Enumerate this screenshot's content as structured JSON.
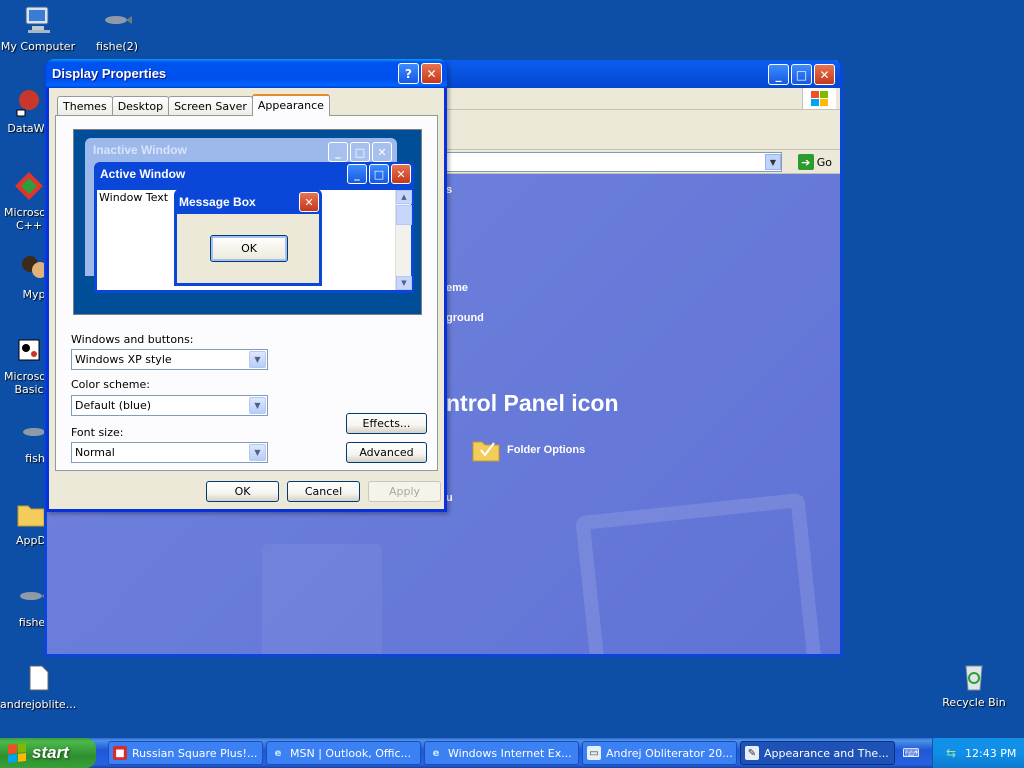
{
  "desktop": {
    "icons": [
      {
        "label": "My Computer",
        "icon": "computer-icon"
      },
      {
        "label": "fishe(2)",
        "icon": "fish-icon"
      },
      {
        "label": "DataWa",
        "icon": "datawa-icon"
      },
      {
        "label": "Microsoft C++",
        "icon": "visual-cpp-icon"
      },
      {
        "label": "Myp",
        "icon": "myp-icon"
      },
      {
        "label": "Microsoft Basic",
        "icon": "visual-basic-icon"
      },
      {
        "label": "fish",
        "icon": "fish-icon"
      },
      {
        "label": "AppD",
        "icon": "folder-icon"
      },
      {
        "label": "fishe",
        "icon": "fish-icon"
      },
      {
        "label": "andrejoblite...",
        "icon": "document-icon"
      },
      {
        "label": "Recycle Bin",
        "icon": "recycle-bin-icon"
      }
    ]
  },
  "control_panel": {
    "go_label": "Go",
    "task_text_1": "s",
    "task_text_2": "eme",
    "task_text_3": "ground",
    "heading": "ntrol Panel icon",
    "folder_options": "Folder Options",
    "task_text_4": "u"
  },
  "dialog": {
    "title": "Display Properties",
    "help_button": "?",
    "close_button": "✕",
    "tabs": [
      {
        "label": "Themes",
        "active": false
      },
      {
        "label": "Desktop",
        "active": false
      },
      {
        "label": "Screen Saver",
        "active": false
      },
      {
        "label": "Appearance",
        "active": true
      }
    ],
    "preview": {
      "inactive_title": "Inactive Window",
      "active_title": "Active Window",
      "window_text": "Window Text",
      "message_title": "Message Box",
      "message_ok": "OK"
    },
    "windows_buttons_label": "Windows and buttons:",
    "windows_buttons_value": "Windows XP style",
    "color_scheme_label": "Color scheme:",
    "color_scheme_value": "Default (blue)",
    "font_size_label": "Font size:",
    "font_size_value": "Normal",
    "effects_button": "Effects...",
    "advanced_button": "Advanced",
    "ok_button": "OK",
    "cancel_button": "Cancel",
    "apply_button": "Apply"
  },
  "taskbar": {
    "start_label": "start",
    "tasks": [
      {
        "label": "Russian Square Plus!...",
        "icon": "russian-square-icon",
        "active": false
      },
      {
        "label": "MSN | Outlook, Offic...",
        "icon": "ie-icon",
        "active": false
      },
      {
        "label": "Windows Internet Ex...",
        "icon": "ie-icon",
        "active": false
      },
      {
        "label": "Andrej Obliterator 20...",
        "icon": "app-window-icon",
        "active": false
      },
      {
        "label": "Appearance and The...",
        "icon": "control-panel-icon",
        "active": true
      }
    ],
    "clock": "12:43 PM"
  },
  "colors": {
    "desktop": "#0d4fa6",
    "title_bar": "#0050ee",
    "dialog_face": "#ece9d8",
    "taskbar": "#245edb",
    "start_green": "#37a037"
  }
}
